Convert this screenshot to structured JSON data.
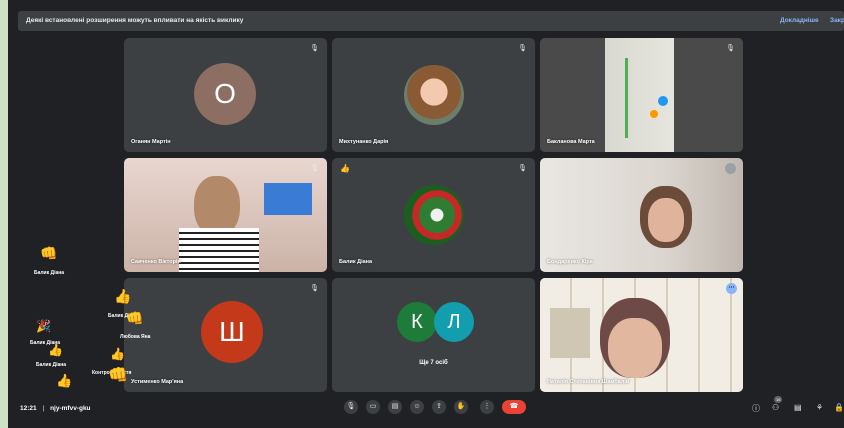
{
  "banner": {
    "message": "Деякі встановлені розширення можуть впливати на якість виклику",
    "details_label": "Докладніше",
    "close_label": "Закрити"
  },
  "tiles": [
    {
      "name": "Оганян Мартін",
      "initial": "О",
      "avatar_color": "#8d6e63"
    },
    {
      "name": "Михтунанко Дарія"
    },
    {
      "name": "Бакланова Марта"
    },
    {
      "name": "Савченко Вікторія"
    },
    {
      "name": "Балик Діана",
      "reaction": "👍"
    },
    {
      "name": "Бондаренко Кіра"
    },
    {
      "name": "Устименко Мар'яна",
      "initial": "Ш",
      "avatar_color": "#c5391b"
    },
    {
      "more_label": "Ще 7 осіб",
      "initial1": "К",
      "initial2": "Л",
      "color1": "#1e7c3a",
      "color2": "#129eaf"
    },
    {
      "name": "Наталія Степанівна Шамбалій"
    }
  ],
  "reactions": [
    {
      "name": "Балик Діана",
      "emoji": "👊"
    },
    {
      "name": "Балик Діана",
      "emoji": "👍"
    },
    {
      "name": "Любова Яна",
      "emoji": "👊"
    },
    {
      "name": "Балик Діана",
      "emoji": "🎉"
    },
    {
      "name": "Балик Діана",
      "emoji": "👍"
    },
    {
      "name": "Контрова Настя",
      "emoji": "👍"
    },
    {
      "name": "Балик Діана",
      "emoji": "👍"
    }
  ],
  "bottom": {
    "time": "12:21",
    "separator": "|",
    "meeting_code": "njy-mfvv-gku",
    "participants_count": "16"
  },
  "colors": {
    "accent": "#8ab4f8",
    "end_call": "#ea4335",
    "background": "#202124",
    "tile": "#3c4043"
  },
  "icons": {
    "mic": "mic-icon",
    "camera": "camera-icon",
    "captions": "captions-icon",
    "emoji": "emoji-icon",
    "present": "present-icon",
    "hand": "raise-hand-icon",
    "more": "more-options-icon",
    "end": "end-call-icon",
    "info": "info-icon",
    "people": "people-icon",
    "chat": "chat-icon",
    "activities": "activities-icon",
    "lock": "lock-icon"
  }
}
